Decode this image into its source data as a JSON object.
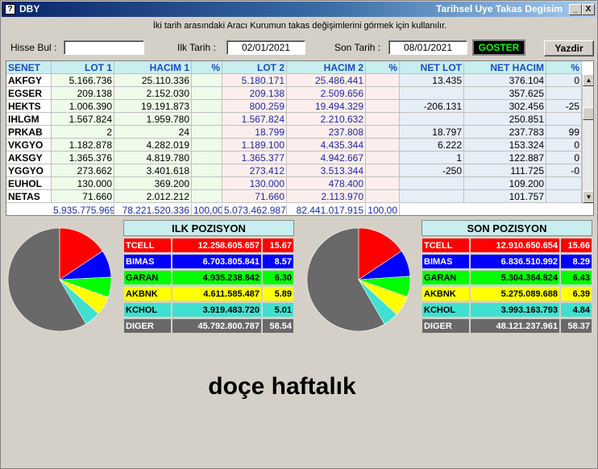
{
  "window": {
    "title": "DBY",
    "title_right": "Tarihsel Uye Takas Degisim",
    "min_glyph": "_",
    "close_glyph": "X"
  },
  "info_text": "İki tarih arasındaki  Aracı Kurumun takas değişimlerini görmek için kullanılır.",
  "controls": {
    "search_label": "Hisse Bul :",
    "search_value": "",
    "start_label": "Ilk Tarih :",
    "start_value": "02/01/2021",
    "end_label": "Son Tarih :",
    "end_value": "08/01/2021",
    "show_button": "GOSTER",
    "print_button": "Yazdir"
  },
  "table": {
    "headers": [
      "SENET",
      "LOT 1",
      "HACIM 1",
      "%",
      "LOT 2",
      "HACIM 2",
      "%",
      "NET LOT",
      "NET HACIM",
      "%"
    ],
    "rows": [
      [
        "AKFGY",
        "5.166.736",
        "25.110.336",
        "",
        "5.180.171",
        "25.486.441",
        "",
        "13.435",
        "376.104",
        "0"
      ],
      [
        "EGSER",
        "209.138",
        "2.152.030",
        "",
        "209.138",
        "2.509.656",
        "",
        "",
        "357.625",
        ""
      ],
      [
        "HEKTS",
        "1.006.390",
        "19.191.873",
        "",
        "800.259",
        "19.494.329",
        "",
        "-206.131",
        "302.456",
        "-25"
      ],
      [
        "IHLGM",
        "1.567.824",
        "1.959.780",
        "",
        "1.567.824",
        "2.210.632",
        "",
        "",
        "250.851",
        ""
      ],
      [
        "PRKAB",
        "2",
        "24",
        "",
        "18.799",
        "237.808",
        "",
        "18.797",
        "237.783",
        "99"
      ],
      [
        "VKGYO",
        "1.182.878",
        "4.282.019",
        "",
        "1.189.100",
        "4.435.344",
        "",
        "6.222",
        "153.324",
        "0"
      ],
      [
        "AKSGY",
        "1.365.376",
        "4.819.780",
        "",
        "1.365.377",
        "4.942.667",
        "",
        "1",
        "122.887",
        "0"
      ],
      [
        "YGGYO",
        "273.662",
        "3.401.618",
        "",
        "273.412",
        "3.513.344",
        "",
        "-250",
        "111.725",
        "-0"
      ],
      [
        "EUHOL",
        "130.000",
        "369.200",
        "",
        "130.000",
        "478.400",
        "",
        "",
        "109.200",
        ""
      ],
      [
        "NETAS",
        "71.660",
        "2.012.212",
        "",
        "71.660",
        "2.113.970",
        "",
        "",
        "101.757",
        ""
      ]
    ],
    "totals": [
      "5.935.775.969",
      "78.221.520.336",
      "100,00",
      "5.073.462.987",
      "82.441.017.915",
      "100,00"
    ],
    "scroll_up": "▲",
    "scroll_down": "▼"
  },
  "ilk_pozisyon": {
    "title": "ILK POZISYON",
    "rows": [
      {
        "name": "TCELL",
        "value": "12.258.605.657",
        "pct": "15.67",
        "color": "#ff0000",
        "text": "#ffffff"
      },
      {
        "name": "BIMAS",
        "value": "6.703.805.841",
        "pct": "8.57",
        "color": "#0000ff",
        "text": "#ffffff"
      },
      {
        "name": "GARAN",
        "value": "4.935.238.842",
        "pct": "6.30",
        "color": "#00ff00",
        "text": "#000000"
      },
      {
        "name": "AKBNK",
        "value": "4.611.585.487",
        "pct": "5.89",
        "color": "#ffff00",
        "text": "#000000"
      },
      {
        "name": "KCHOL",
        "value": "3.919.483.720",
        "pct": "5.01",
        "color": "#40e0d0",
        "text": "#000000"
      },
      {
        "name": "DIGER",
        "value": "45.792.800.787",
        "pct": "58.54",
        "color": "#696969",
        "text": "#ffffff"
      }
    ]
  },
  "son_pozisyon": {
    "title": "SON POZISYON",
    "rows": [
      {
        "name": "TCELL",
        "value": "12.910.650.654",
        "pct": "15.66",
        "color": "#ff0000",
        "text": "#ffffff"
      },
      {
        "name": "BIMAS",
        "value": "6.836.510.992",
        "pct": "8.29",
        "color": "#0000ff",
        "text": "#ffffff"
      },
      {
        "name": "GARAN",
        "value": "5.304.364.824",
        "pct": "6.43",
        "color": "#00ff00",
        "text": "#000000"
      },
      {
        "name": "AKBNK",
        "value": "5.275.089.688",
        "pct": "6.39",
        "color": "#ffff00",
        "text": "#000000"
      },
      {
        "name": "KCHOL",
        "value": "3.993.163.793",
        "pct": "4.84",
        "color": "#40e0d0",
        "text": "#000000"
      },
      {
        "name": "DIGER",
        "value": "48.121.237.961",
        "pct": "58.37",
        "color": "#696969",
        "text": "#ffffff"
      }
    ]
  },
  "caption": "doçe haftalık"
}
